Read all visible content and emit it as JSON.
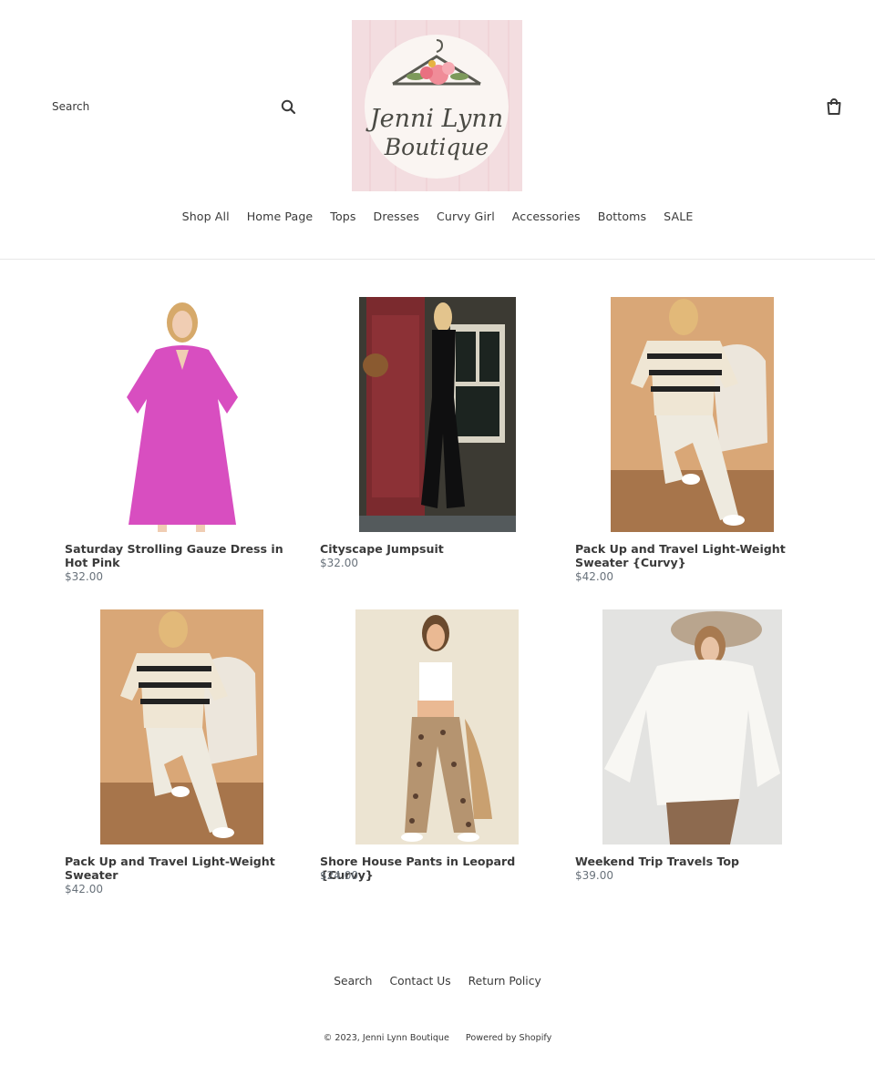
{
  "header": {
    "search_placeholder": "Search",
    "logo_text_line1": "Jenni Lynn",
    "logo_text_line2": "Boutique",
    "icons": {
      "search": "search-icon",
      "cart": "cart-icon"
    }
  },
  "nav": {
    "items": [
      {
        "label": "Shop All"
      },
      {
        "label": "Home Page"
      },
      {
        "label": "Tops"
      },
      {
        "label": "Dresses"
      },
      {
        "label": "Curvy Girl"
      },
      {
        "label": "Accessories"
      },
      {
        "label": "Bottoms"
      },
      {
        "label": "SALE"
      }
    ]
  },
  "products": [
    {
      "title": "Saturday Strolling Gauze Dress in Hot Pink",
      "price": "$32.00",
      "image": "pink-dress-photo"
    },
    {
      "title": "Cityscape Jumpsuit",
      "price": "$32.00",
      "image": "black-jumpsuit-photo"
    },
    {
      "title": "Pack Up and Travel Light-Weight Sweater {Curvy}",
      "price": "$42.00",
      "image": "striped-sweater-photo"
    },
    {
      "title": "Pack Up and Travel Light-Weight Sweater",
      "price": "$42.00",
      "image": "striped-sweater-photo"
    },
    {
      "title": "Shore House Pants in Leopard {Curvy}",
      "price": "$24.00",
      "image": "leopard-pants-photo"
    },
    {
      "title": "Weekend Trip Travels Top",
      "price": "$39.00",
      "image": "white-top-photo"
    }
  ],
  "footer": {
    "links": [
      {
        "label": "Search"
      },
      {
        "label": "Contact Us"
      },
      {
        "label": "Return Policy"
      }
    ],
    "copyright": "© 2023, Jenni Lynn Boutique",
    "powered_by": "Powered by Shopify"
  },
  "colors": {
    "text": "#3a3a3a",
    "price": "#69727b",
    "logo_bg": "#f3dde0",
    "divider": "#e8e8e8"
  }
}
